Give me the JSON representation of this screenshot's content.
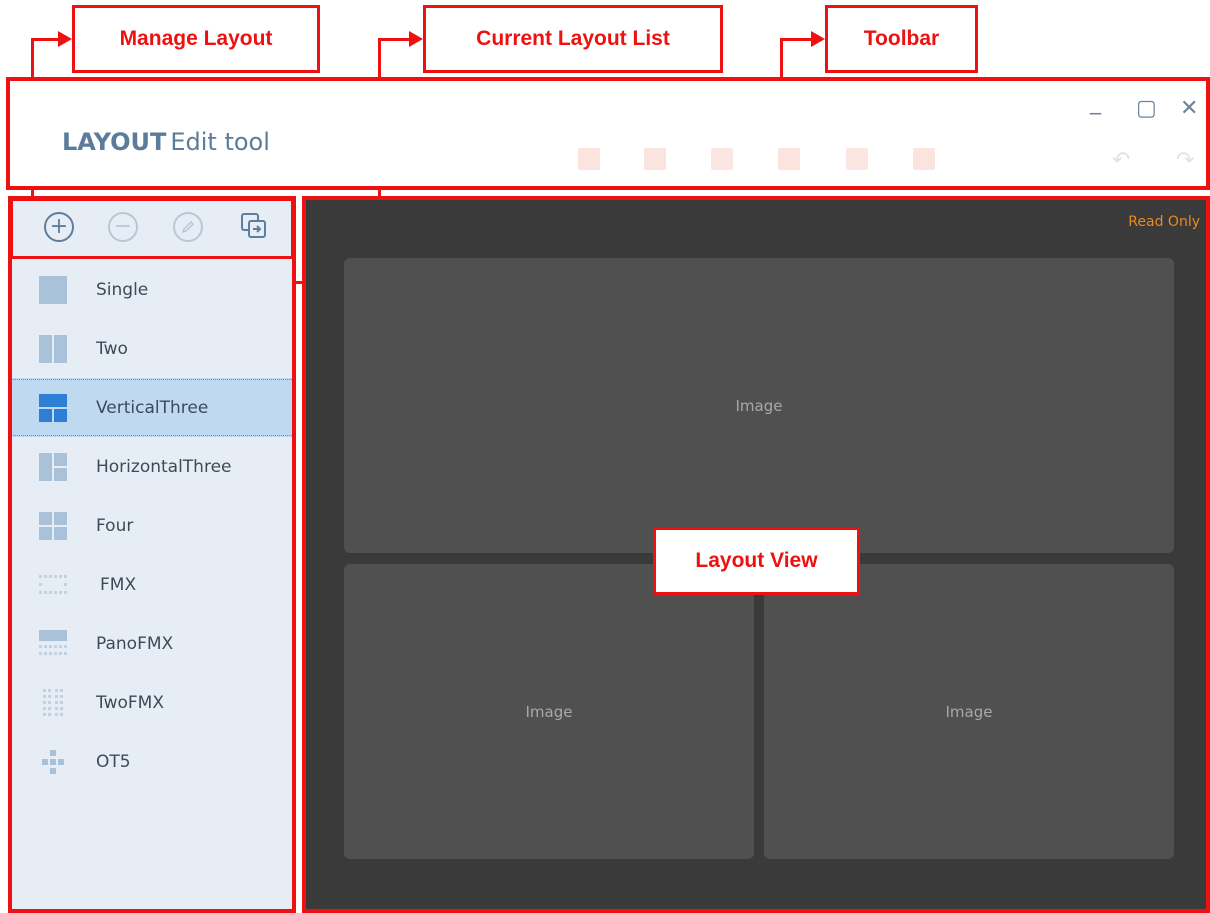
{
  "annotations": {
    "manage_layout": "Manage Layout",
    "current_layout_list": "Current Layout List",
    "toolbar": "Toolbar",
    "layout_view": "Layout View"
  },
  "window": {
    "title_bold": "LAYOUT",
    "title_rest": "Edit tool",
    "minimize": "_",
    "maximize": "▢",
    "close": "✕",
    "undo": "↶",
    "redo": "↷"
  },
  "layout_list": [
    {
      "label": "Single",
      "icon": "single-layout-icon"
    },
    {
      "label": "Two",
      "icon": "two-layout-icon"
    },
    {
      "label": "VerticalThree",
      "icon": "vertical-three-layout-icon",
      "selected": true
    },
    {
      "label": "HorizontalThree",
      "icon": "horizontal-three-layout-icon"
    },
    {
      "label": "Four",
      "icon": "four-layout-icon"
    },
    {
      "label": "FMX",
      "icon": "fmx-layout-icon"
    },
    {
      "label": "PanoFMX",
      "icon": "panofmx-layout-icon"
    },
    {
      "label": "TwoFMX",
      "icon": "twofmx-layout-icon"
    },
    {
      "label": "OT5",
      "icon": "ot5-layout-icon"
    }
  ],
  "view": {
    "read_only": "Read Only",
    "panes": [
      "Image",
      "Image",
      "Image"
    ]
  },
  "colors": {
    "annotation": "#ee1111",
    "accent": "#5b7c9a",
    "selected_bg": "#bfd9f1",
    "view_bg": "#3a3a3a",
    "pane_bg": "#505050",
    "read_only": "#e98a1e"
  }
}
